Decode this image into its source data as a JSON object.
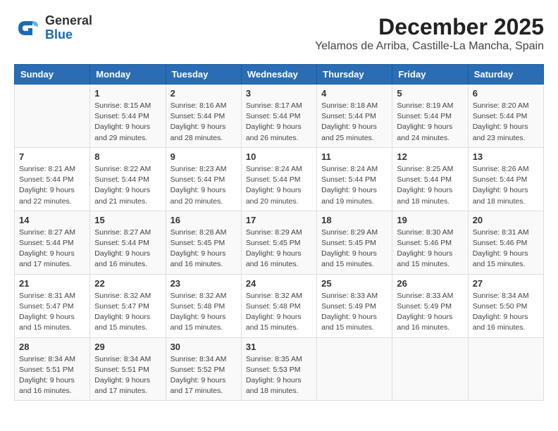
{
  "logo": {
    "general": "General",
    "blue": "Blue"
  },
  "header": {
    "month": "December 2025",
    "location": "Yelamos de Arriba, Castille-La Mancha, Spain"
  },
  "weekdays": [
    "Sunday",
    "Monday",
    "Tuesday",
    "Wednesday",
    "Thursday",
    "Friday",
    "Saturday"
  ],
  "weeks": [
    [
      {
        "day": "",
        "info": ""
      },
      {
        "day": "1",
        "info": "Sunrise: 8:15 AM\nSunset: 5:44 PM\nDaylight: 9 hours\nand 29 minutes."
      },
      {
        "day": "2",
        "info": "Sunrise: 8:16 AM\nSunset: 5:44 PM\nDaylight: 9 hours\nand 28 minutes."
      },
      {
        "day": "3",
        "info": "Sunrise: 8:17 AM\nSunset: 5:44 PM\nDaylight: 9 hours\nand 26 minutes."
      },
      {
        "day": "4",
        "info": "Sunrise: 8:18 AM\nSunset: 5:44 PM\nDaylight: 9 hours\nand 25 minutes."
      },
      {
        "day": "5",
        "info": "Sunrise: 8:19 AM\nSunset: 5:44 PM\nDaylight: 9 hours\nand 24 minutes."
      },
      {
        "day": "6",
        "info": "Sunrise: 8:20 AM\nSunset: 5:44 PM\nDaylight: 9 hours\nand 23 minutes."
      }
    ],
    [
      {
        "day": "7",
        "info": "Sunrise: 8:21 AM\nSunset: 5:44 PM\nDaylight: 9 hours\nand 22 minutes."
      },
      {
        "day": "8",
        "info": "Sunrise: 8:22 AM\nSunset: 5:44 PM\nDaylight: 9 hours\nand 21 minutes."
      },
      {
        "day": "9",
        "info": "Sunrise: 8:23 AM\nSunset: 5:44 PM\nDaylight: 9 hours\nand 20 minutes."
      },
      {
        "day": "10",
        "info": "Sunrise: 8:24 AM\nSunset: 5:44 PM\nDaylight: 9 hours\nand 20 minutes."
      },
      {
        "day": "11",
        "info": "Sunrise: 8:24 AM\nSunset: 5:44 PM\nDaylight: 9 hours\nand 19 minutes."
      },
      {
        "day": "12",
        "info": "Sunrise: 8:25 AM\nSunset: 5:44 PM\nDaylight: 9 hours\nand 18 minutes."
      },
      {
        "day": "13",
        "info": "Sunrise: 8:26 AM\nSunset: 5:44 PM\nDaylight: 9 hours\nand 18 minutes."
      }
    ],
    [
      {
        "day": "14",
        "info": "Sunrise: 8:27 AM\nSunset: 5:44 PM\nDaylight: 9 hours\nand 17 minutes."
      },
      {
        "day": "15",
        "info": "Sunrise: 8:27 AM\nSunset: 5:44 PM\nDaylight: 9 hours\nand 16 minutes."
      },
      {
        "day": "16",
        "info": "Sunrise: 8:28 AM\nSunset: 5:45 PM\nDaylight: 9 hours\nand 16 minutes."
      },
      {
        "day": "17",
        "info": "Sunrise: 8:29 AM\nSunset: 5:45 PM\nDaylight: 9 hours\nand 16 minutes."
      },
      {
        "day": "18",
        "info": "Sunrise: 8:29 AM\nSunset: 5:45 PM\nDaylight: 9 hours\nand 15 minutes."
      },
      {
        "day": "19",
        "info": "Sunrise: 8:30 AM\nSunset: 5:46 PM\nDaylight: 9 hours\nand 15 minutes."
      },
      {
        "day": "20",
        "info": "Sunrise: 8:31 AM\nSunset: 5:46 PM\nDaylight: 9 hours\nand 15 minutes."
      }
    ],
    [
      {
        "day": "21",
        "info": "Sunrise: 8:31 AM\nSunset: 5:47 PM\nDaylight: 9 hours\nand 15 minutes."
      },
      {
        "day": "22",
        "info": "Sunrise: 8:32 AM\nSunset: 5:47 PM\nDaylight: 9 hours\nand 15 minutes."
      },
      {
        "day": "23",
        "info": "Sunrise: 8:32 AM\nSunset: 5:48 PM\nDaylight: 9 hours\nand 15 minutes."
      },
      {
        "day": "24",
        "info": "Sunrise: 8:32 AM\nSunset: 5:48 PM\nDaylight: 9 hours\nand 15 minutes."
      },
      {
        "day": "25",
        "info": "Sunrise: 8:33 AM\nSunset: 5:49 PM\nDaylight: 9 hours\nand 15 minutes."
      },
      {
        "day": "26",
        "info": "Sunrise: 8:33 AM\nSunset: 5:49 PM\nDaylight: 9 hours\nand 16 minutes."
      },
      {
        "day": "27",
        "info": "Sunrise: 8:34 AM\nSunset: 5:50 PM\nDaylight: 9 hours\nand 16 minutes."
      }
    ],
    [
      {
        "day": "28",
        "info": "Sunrise: 8:34 AM\nSunset: 5:51 PM\nDaylight: 9 hours\nand 16 minutes."
      },
      {
        "day": "29",
        "info": "Sunrise: 8:34 AM\nSunset: 5:51 PM\nDaylight: 9 hours\nand 17 minutes."
      },
      {
        "day": "30",
        "info": "Sunrise: 8:34 AM\nSunset: 5:52 PM\nDaylight: 9 hours\nand 17 minutes."
      },
      {
        "day": "31",
        "info": "Sunrise: 8:35 AM\nSunset: 5:53 PM\nDaylight: 9 hours\nand 18 minutes."
      },
      {
        "day": "",
        "info": ""
      },
      {
        "day": "",
        "info": ""
      },
      {
        "day": "",
        "info": ""
      }
    ]
  ]
}
